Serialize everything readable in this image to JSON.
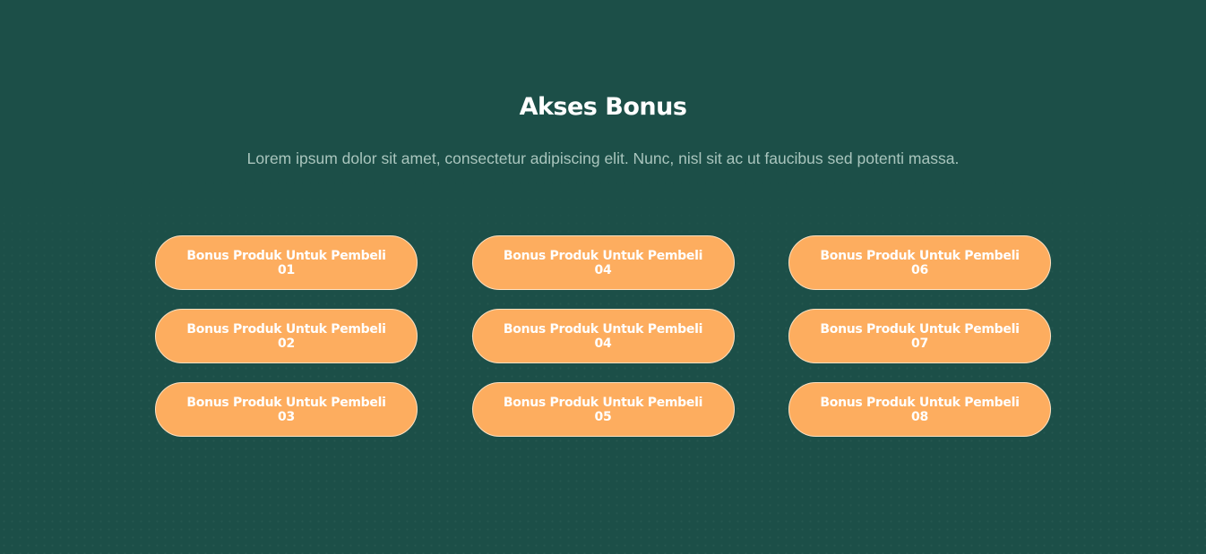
{
  "section": {
    "title": "Akses Bonus",
    "subtitle": "Lorem ipsum dolor sit amet, consectetur adipiscing elit. Nunc, nisl sit ac ut faucibus sed potenti massa."
  },
  "bonuses": [
    {
      "label": "Bonus Produk Untuk Pembeli 01"
    },
    {
      "label": "Bonus Produk Untuk Pembeli 02"
    },
    {
      "label": "Bonus Produk Untuk Pembeli 03"
    },
    {
      "label": "Bonus Produk Untuk Pembeli 04"
    },
    {
      "label": "Bonus Produk Untuk Pembeli 04"
    },
    {
      "label": "Bonus Produk Untuk Pembeli 05"
    },
    {
      "label": "Bonus Produk Untuk Pembeli 06"
    },
    {
      "label": "Bonus Produk Untuk Pembeli 07"
    },
    {
      "label": "Bonus Produk Untuk Pembeli 08"
    }
  ],
  "colors": {
    "background": "#1c4f48",
    "button": "#fdad5f",
    "text": "#ffffff",
    "subtitle": "#a9c5bd"
  }
}
